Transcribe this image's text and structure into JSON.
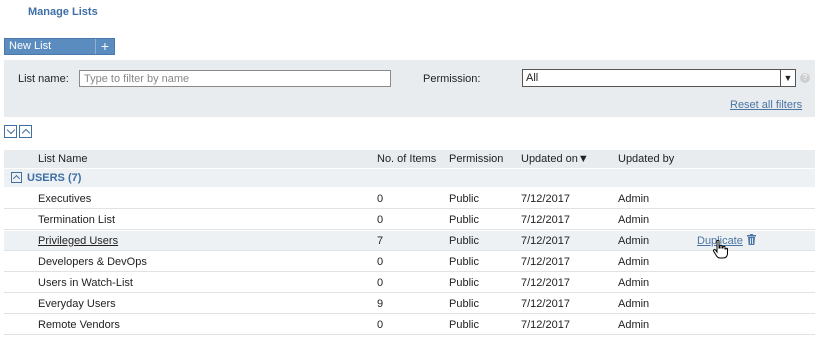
{
  "page_title": "Manage Lists",
  "new_list_button": {
    "label": "New List",
    "icon": "plus-icon"
  },
  "filters": {
    "name_label": "List name:",
    "name_placeholder": "Type to filter by name",
    "name_value": "",
    "permission_label": "Permission:",
    "permission_value": "All",
    "reset_label": "Reset all filters"
  },
  "table": {
    "columns": [
      "List Name",
      "No. of Items",
      "Permission",
      "Updated on▼",
      "Updated by"
    ],
    "sort_column": "Updated on",
    "sort_direction": "desc",
    "group": {
      "label": "USERS (7)"
    },
    "rows": [
      {
        "name": "Executives",
        "items": "0",
        "permission": "Public",
        "updated_on": "7/12/2017",
        "updated_by": "Admin"
      },
      {
        "name": "Termination List",
        "items": "0",
        "permission": "Public",
        "updated_on": "7/12/2017",
        "updated_by": "Admin"
      },
      {
        "name": "Privileged Users",
        "items": "7",
        "permission": "Public",
        "updated_on": "7/12/2017",
        "updated_by": "Admin",
        "hovered": true,
        "action_label": "Duplicate"
      },
      {
        "name": "Developers & DevOps",
        "items": "0",
        "permission": "Public",
        "updated_on": "7/12/2017",
        "updated_by": "Admin"
      },
      {
        "name": "Users in Watch-List",
        "items": "0",
        "permission": "Public",
        "updated_on": "7/12/2017",
        "updated_by": "Admin"
      },
      {
        "name": "Everyday Users",
        "items": "9",
        "permission": "Public",
        "updated_on": "7/12/2017",
        "updated_by": "Admin"
      },
      {
        "name": "Remote Vendors",
        "items": "0",
        "permission": "Public",
        "updated_on": "7/12/2017",
        "updated_by": "Admin"
      }
    ]
  },
  "colors": {
    "accent": "#3d6ea5",
    "button": "#5b8cc0",
    "panel": "#e8ecef",
    "link": "#4a74a3"
  }
}
